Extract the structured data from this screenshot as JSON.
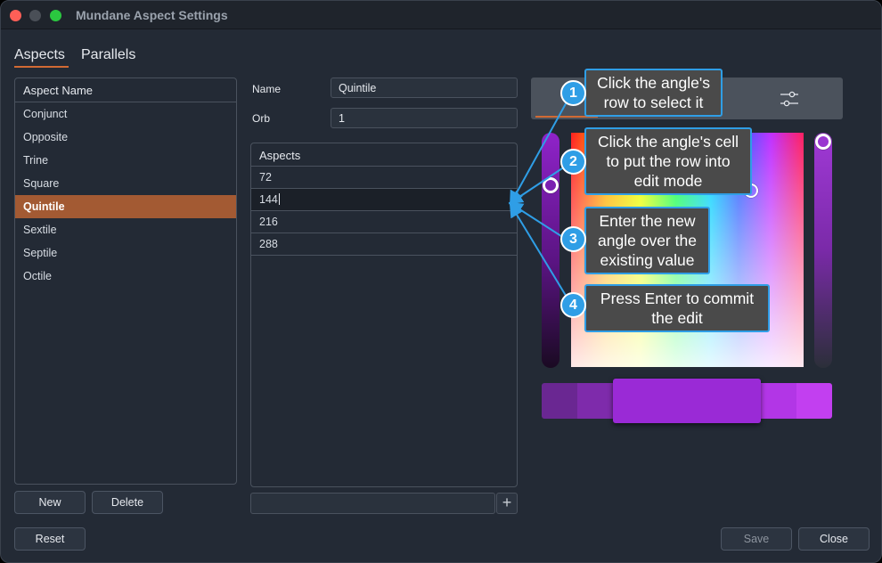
{
  "window": {
    "title": "Mundane Aspect Settings"
  },
  "tabs": [
    {
      "label": "Aspects",
      "active": true
    },
    {
      "label": "Parallels",
      "active": false
    }
  ],
  "aspect_list": {
    "header": "Aspect Name",
    "items": [
      "Conjunct",
      "Opposite",
      "Trine",
      "Square",
      "Quintile",
      "Sextile",
      "Septile",
      "Octile"
    ],
    "selected": "Quintile"
  },
  "fields": {
    "name_label": "Name",
    "name_value": "Quintile",
    "orb_label": "Orb",
    "orb_value": "1"
  },
  "angles": {
    "header": "Aspects",
    "rows": [
      "72",
      "144",
      "216",
      "288"
    ],
    "editing_row": "144"
  },
  "buttons": {
    "new": "New",
    "delete": "Delete",
    "reset": "Reset",
    "save": "Save",
    "close": "Close",
    "add": "+"
  },
  "color_picker": {
    "selected_color": "#9a2ad6",
    "swatches": [
      "#6a2792",
      "#7e2bab",
      "#9a2ad6",
      "#b236e6",
      "#c23ff0"
    ]
  },
  "callouts": [
    {
      "number": "1",
      "text": "Click the angle's row to select it"
    },
    {
      "number": "2",
      "text": "Click the angle's cell to put the row into edit mode"
    },
    {
      "number": "3",
      "text": "Enter the new angle over the existing value"
    },
    {
      "number": "4",
      "text": "Press Enter to commit the edit"
    }
  ],
  "colors": {
    "accent": "#d16a34",
    "selection": "#a35a33",
    "callout_border": "#2f9ee6"
  }
}
